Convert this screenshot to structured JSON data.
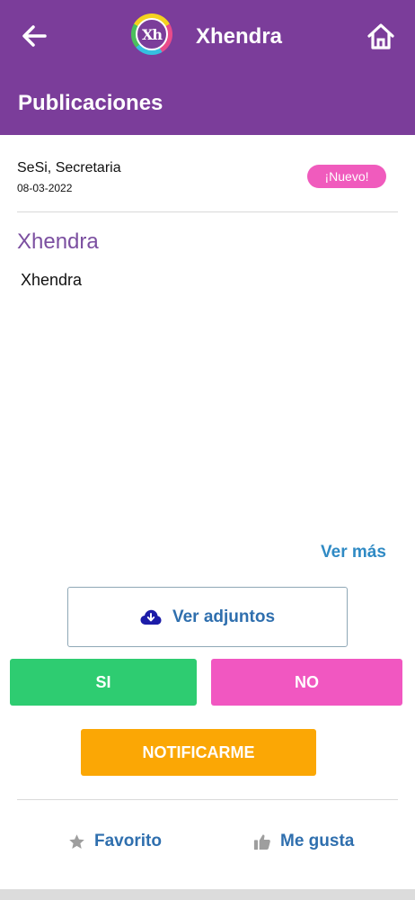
{
  "header": {
    "logo_text": "Xh",
    "app_title": "Xhendra",
    "section_title": "Publicaciones",
    "back_icon": "arrow-left-icon",
    "home_icon": "home-icon",
    "color": "#7b3d9a"
  },
  "post": {
    "author": "SeSi, Secretaria",
    "date": "08-03-2022",
    "badge": "¡Nuevo!",
    "title": "Xhendra",
    "body": "Xhendra"
  },
  "actions": {
    "ver_mas": "Ver más",
    "ver_adjuntos": "Ver adjuntos",
    "si": "SI",
    "no": "NO",
    "notificarme": "NOTIFICARME",
    "favorito": "Favorito",
    "me_gusta": "Me gusta"
  },
  "colors": {
    "badge": "#f05bbd",
    "si": "#2ecc71",
    "no": "#f157c1",
    "notify": "#fba705",
    "link": "#2f6fae"
  }
}
